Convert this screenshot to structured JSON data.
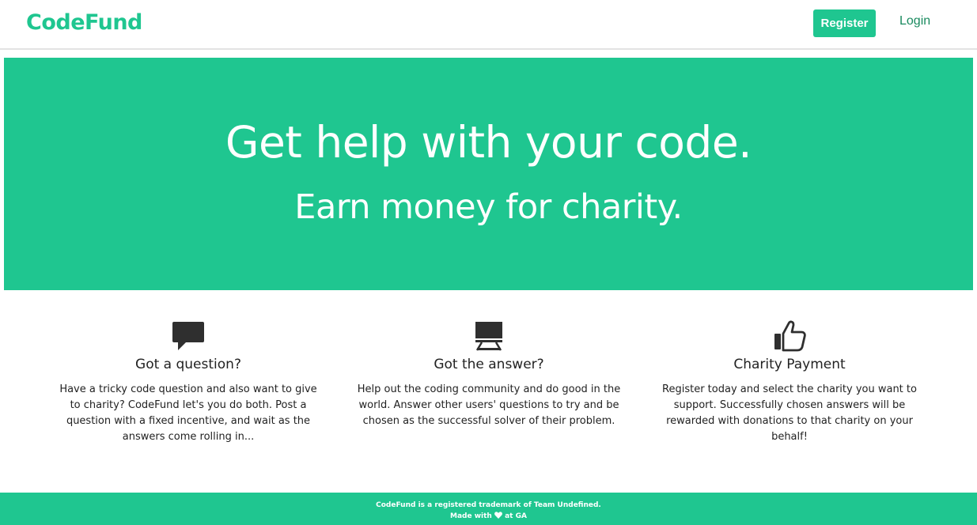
{
  "nav": {
    "brand": "CodeFund",
    "register_label": "Register",
    "login_label": "Login"
  },
  "hero": {
    "title": "Get help with your code.",
    "subtitle": "Earn money for charity."
  },
  "features": [
    {
      "icon": "speech-bubble-icon",
      "title": "Got a question?",
      "text": "Have a tricky code question and also want to give to charity? CodeFund let's you do both. Post a question with a fixed incentive, and wait as the answers come rolling in..."
    },
    {
      "icon": "presentation-board-icon",
      "title": "Got the answer?",
      "text": "Help out the coding community and do good in the world. Answer other users' questions to try and be chosen as the successful solver of their problem."
    },
    {
      "icon": "thumbs-up-icon",
      "title": "Charity Payment",
      "text": "Register today and select the charity you want to support. Successfully chosen answers will be rewarded with donations to that charity on your behalf!"
    }
  ],
  "footer": {
    "line1": "CodeFund is a registered trademark of Team Undefined.",
    "line2_before": "Made with",
    "heart_icon": "heart-icon",
    "line2_after": "at GA"
  },
  "colors": {
    "brand_green": "#1fc690",
    "login_link": "#1a8a5f",
    "text_dark": "#222222"
  }
}
